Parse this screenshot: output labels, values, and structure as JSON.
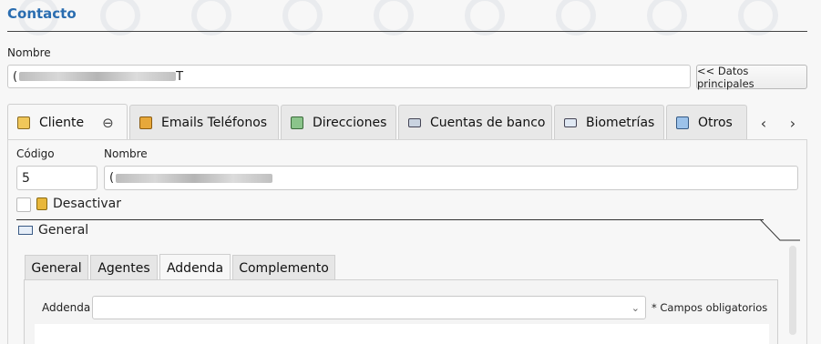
{
  "section": {
    "title": "Contacto"
  },
  "header": {
    "nombre_label": "Nombre",
    "nombre_value_prefix": "(",
    "nombre_value_suffix": "T",
    "datos_button": "<< Datos principales"
  },
  "tabs": [
    {
      "label": "Cliente",
      "icon": "folder-user-icon",
      "active": true
    },
    {
      "label": "Emails Teléfonos",
      "icon": "address-book-icon"
    },
    {
      "label": "Direcciones",
      "icon": "map-icon"
    },
    {
      "label": "Cuentas de banco",
      "icon": "bank-card-icon"
    },
    {
      "label": "Biometrías",
      "icon": "id-card-icon"
    },
    {
      "label": "Otros",
      "icon": "grid-icon"
    }
  ],
  "tab_close_icon": "⊖",
  "nav": {
    "prev": "‹",
    "next": "›"
  },
  "cliente": {
    "codigo_label": "Código",
    "codigo_value": "5",
    "nombre_label": "Nombre",
    "nombre_value_prefix": "(",
    "desactivar_label": "Desactivar",
    "group_label": "General"
  },
  "subtabs": [
    {
      "label": "General"
    },
    {
      "label": "Agentes"
    },
    {
      "label": "Addenda",
      "active": true
    },
    {
      "label": "Complemento"
    }
  ],
  "addenda": {
    "label": "Addenda",
    "value": "",
    "required_note": "* Campos obligatorios"
  },
  "colors": {
    "accent": "#2a6db0"
  }
}
